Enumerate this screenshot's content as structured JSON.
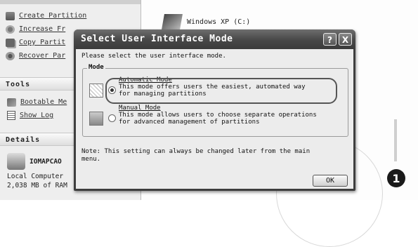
{
  "background_app": {
    "operations": [
      {
        "label": "Create Partition",
        "icon": "create-partition-icon"
      },
      {
        "label": "Increase Fr",
        "icon": "increase-space-icon"
      },
      {
        "label": "Copy Partit",
        "icon": "copy-partition-icon"
      },
      {
        "label": "Recover Par",
        "icon": "recover-partition-icon"
      }
    ],
    "tools_header": "Tools",
    "tools": [
      {
        "label": "Bootable Me",
        "icon": "bootable-media-icon"
      },
      {
        "label": "Show Log",
        "icon": "show-log-icon"
      }
    ],
    "details_header": "Details",
    "details": {
      "drive_label": "IOMAPCAO",
      "type": "Local Computer",
      "memory": "2,038 MB of RAM"
    },
    "drive_name": "Windows XP (C:)"
  },
  "dialog": {
    "title": "Select User Interface Mode",
    "help_glyph": "?",
    "close_glyph": "X",
    "instruction": "Please select the user interface mode.",
    "group_label": "Mode",
    "options": [
      {
        "title": "Automatic Mode",
        "desc_lines": [
          "This mode offers users the easiest, automated way",
          "for managing partitions"
        ],
        "selected": true,
        "icon": "automatic-mode-icon"
      },
      {
        "title": "Manual Mode",
        "desc_lines": [
          "This mode allows users to choose separate operations",
          "for advanced management of partitions"
        ],
        "selected": false,
        "icon": "manual-mode-icon"
      }
    ],
    "note": "Note: This setting can always be changed later from the main menu.",
    "ok_label": "OK"
  },
  "callout_number": "1",
  "colors": {
    "title_bar": "#474747",
    "dialog_body": "#ececec",
    "callout_badge": "#1a1a1a"
  }
}
